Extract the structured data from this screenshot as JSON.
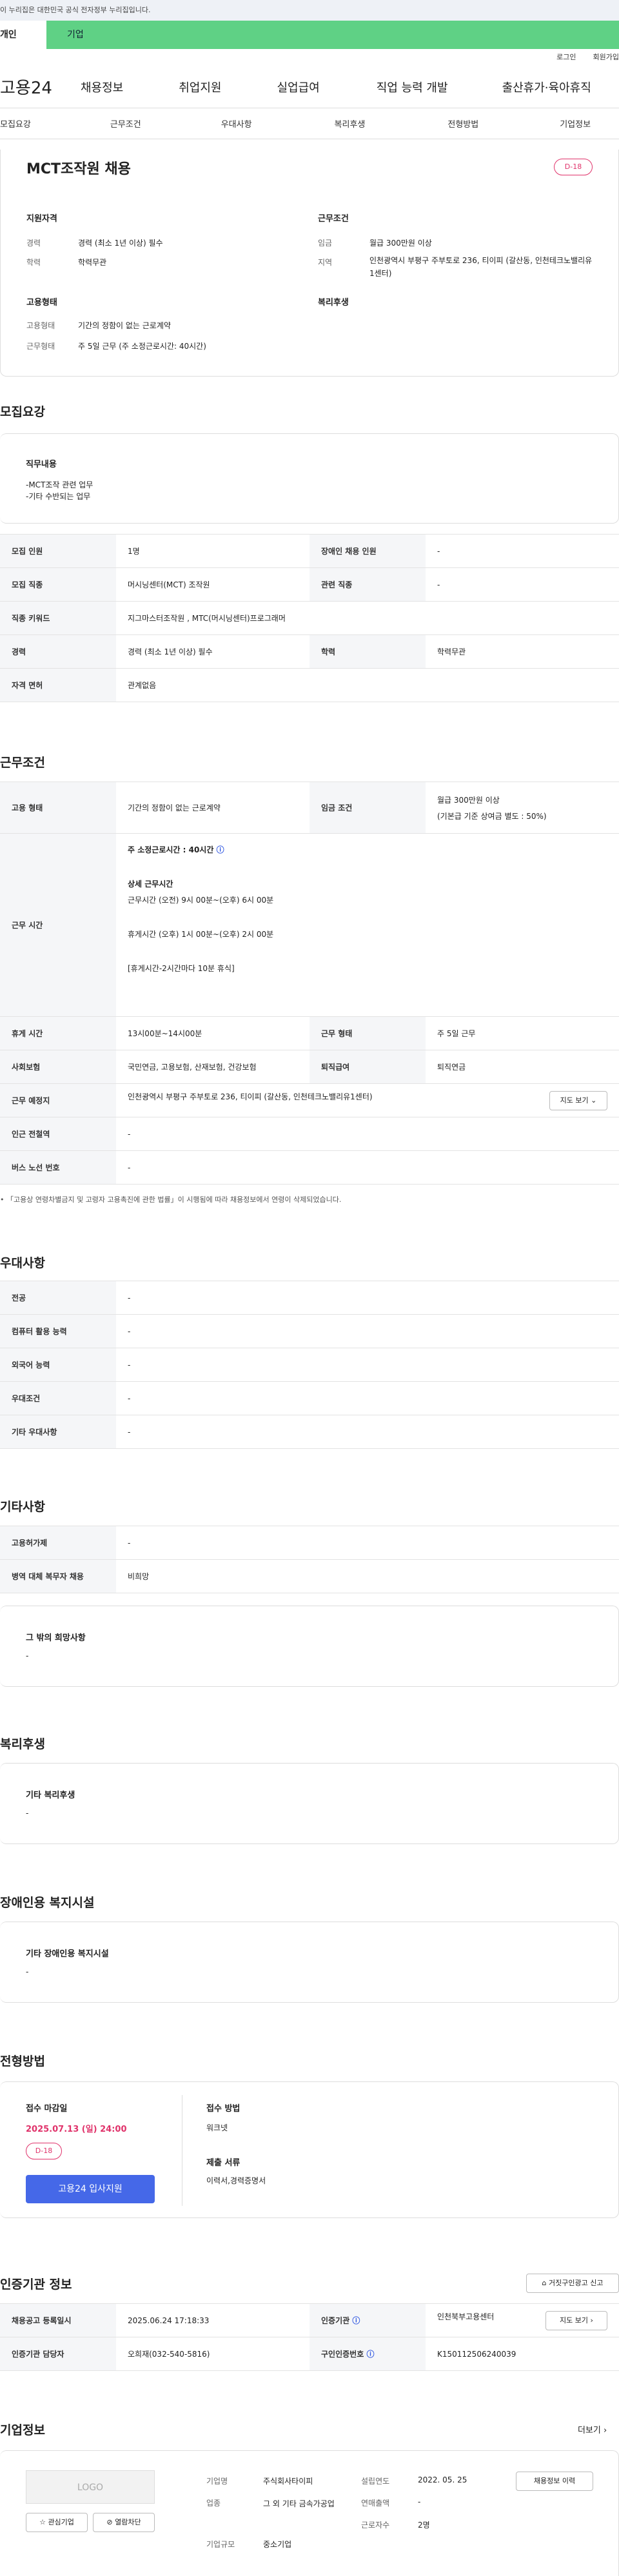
{
  "notice": "이 누리집은 대한민국 공식 전자정부 누리집입니다.",
  "tabs": {
    "personal": "개인",
    "company": "기업"
  },
  "util": {
    "login": "로그인",
    "join": "회원가입"
  },
  "gnb": {
    "logo": "고용24",
    "items": [
      "채용정보",
      "취업지원",
      "실업급여",
      "직업 능력 개발",
      "출산휴가·육아휴직"
    ]
  },
  "lnb": [
    "모집요강",
    "근무조건",
    "우대사항",
    "복리후생",
    "전형방법",
    "기업정보"
  ],
  "summary": {
    "title": "MCT조작원 채용",
    "dday": "D-18",
    "qual_h": "지원자격",
    "qual": [
      {
        "k": "경력",
        "v": "경력 (최소 1년 이상) 필수"
      },
      {
        "k": "학력",
        "v": "학력무관"
      }
    ],
    "work_h": "근무조건",
    "work": [
      {
        "k": "임금",
        "v": "월급 300만원 이상"
      },
      {
        "k": "지역",
        "v": "인천광역시 부평구 주부토로 236, 티이피 (갈산동, 인천테크노밸리유1센터)"
      }
    ],
    "emp_h": "고용형태",
    "emp": [
      {
        "k": "고용형태",
        "v": "기간의 정함이 없는 근로계약"
      },
      {
        "k": "근무형태",
        "v": "주 5일 근무 (주 소정근로시간: 40시간)"
      }
    ],
    "welfare_h": "복리후생"
  },
  "recruit": {
    "title": "모집요강",
    "duty_h": "직무내용",
    "duty": [
      "-MCT조작 관련 업무",
      "-기타 수반되는 업무"
    ],
    "rows": [
      {
        "k": "모집 인원",
        "v": "1명",
        "k2": "장애인 채용 인원",
        "v2": "-"
      },
      {
        "k": "모집 직종",
        "v": "머시닝센터(MCT) 조작원",
        "k2": "관련 직종",
        "v2": "-"
      },
      {
        "k": "직종 키워드",
        "v": "지그마스터조작원 , MTC(머시닝센터)프로그래머"
      },
      {
        "k": "경력",
        "v": "경력 (최소 1년 이상) 필수",
        "k2": "학력",
        "v2": "학력무관"
      },
      {
        "k": "자격 면허",
        "v": "관계없음"
      }
    ]
  },
  "cond": {
    "title": "근무조건",
    "emp_type_k": "고용 형태",
    "emp_type_v": "기간의 정함이 없는 근로계약",
    "wage_k": "임금 조건",
    "wage_v1": "월급 300만원 이상",
    "wage_v2": "(기본급 기준 상여금 별도 : 50%)",
    "worktime_k": "근무 시간",
    "worktime_main": "주 소정근로시간 : 40시간",
    "detail_h": "상세 근무시간",
    "detail1": "근무시간 (오전) 9시 00분~(오후) 6시 00분",
    "detail2": "휴게시간 (오후) 1시 00분~(오후) 2시 00분",
    "detail3": "[휴게시간-2시간마다 10분 휴식]",
    "rest_k": "휴게 시간",
    "rest_v": "13시00분~14시00분",
    "form_k": "근무 형태",
    "form_v": "주 5일 근무",
    "ins_k": "사회보험",
    "ins_v": "국민연금, 고용보험, 산재보험, 건강보험",
    "sev_k": "퇴직급여",
    "sev_v": "퇴직연금",
    "place_k": "근무 예정지",
    "place_v": "인천광역시 부평구 주부토로 236, 티이피 (갈산동, 인천테크노밸리유1센터)",
    "map_btn": "지도 보기",
    "subway_k": "인근 전철역",
    "subway_v": "-",
    "bus_k": "버스 노선 번호",
    "bus_v": "-",
    "note": "「고용상 연령차별금지 및 고령자 고용촉진에 관한 법률」이 시행됨에 따라 채용정보에서 연령이 삭제되었습니다."
  },
  "pref": {
    "title": "우대사항",
    "rows": [
      {
        "k": "전공",
        "v": "-"
      },
      {
        "k": "컴퓨터 활용 능력",
        "v": "-"
      },
      {
        "k": "외국어 능력",
        "v": "-"
      },
      {
        "k": "우대조건",
        "v": "-"
      },
      {
        "k": "기타 우대사항",
        "v": "-"
      }
    ]
  },
  "etc": {
    "title": "기타사항",
    "rows": [
      {
        "k": "고용허가제",
        "v": "-"
      },
      {
        "k": "병역 대체 복무자 채용",
        "v": "비희망"
      }
    ],
    "other_h": "그 밖의 희망사항",
    "other_v": "-"
  },
  "welfare": {
    "title": "복리후생",
    "h": "기타 복리후생",
    "v": "-"
  },
  "disab": {
    "title": "장애인용 복지시설",
    "h": "기타 장애인용 복지시설",
    "v": "-"
  },
  "select": {
    "title": "전형방법",
    "deadline_h": "접수 마감일",
    "deadline_v": "2025.07.13 (일) 24:00",
    "dday": "D-18",
    "apply_btn": "고용24 입사지원",
    "method_h": "접수 방법",
    "method_v": "워크넷",
    "doc_h": "제출 서류",
    "doc_v": "이력서,경력증명서"
  },
  "agency": {
    "title": "인증기관 정보",
    "report_btn": "거짓구인광고 신고",
    "reg_k": "채용공고 등록일시",
    "reg_v": "2025.06.24 17:18:33",
    "org_k": "인증기관",
    "org_v": "인천북부고용센터",
    "map_btn": "지도 보기",
    "mgr_k": "인증기관 담당자",
    "mgr_v": "오희재(032-540-5816)",
    "no_k": "구인인증번호",
    "no_v": "K150112506240039"
  },
  "company": {
    "title": "기업정보",
    "more": "더보기",
    "logo": "LOGO",
    "fav": "관심기업",
    "block": "열람차단",
    "name_k": "기업명",
    "name_v": "주식회사타이피",
    "ind_k": "업종",
    "ind_v": "그 외 기타 금속가공업",
    "size_k": "기업규모",
    "size_v": "중소기업",
    "est_k": "설립연도",
    "est_v": "2022. 05. 25",
    "rev_k": "연매출액",
    "rev_v": "-",
    "emp_k": "근로자수",
    "emp_v": "2명",
    "hist_btn": "채용정보 이력"
  }
}
